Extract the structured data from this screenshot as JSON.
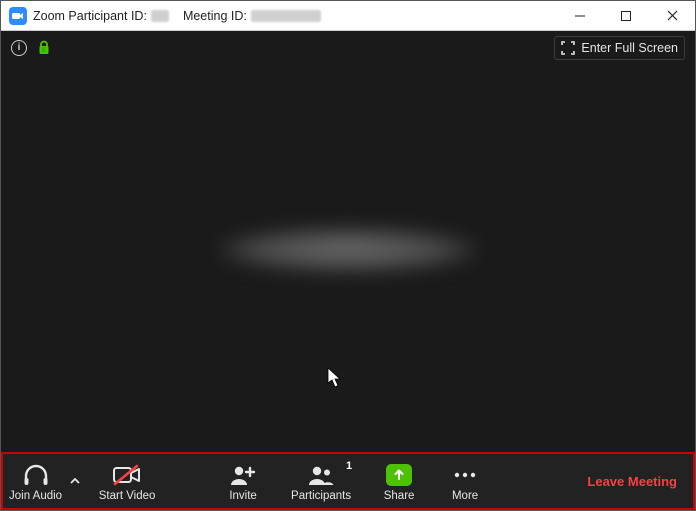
{
  "titlebar": {
    "prefix": "Zoom Participant ID:",
    "meeting_label": "Meeting ID:"
  },
  "infobar": {
    "fullscreen_label": "Enter Full Screen"
  },
  "toolbar": {
    "join_audio": "Join Audio",
    "start_video": "Start Video",
    "invite": "Invite",
    "participants": "Participants",
    "participants_count": "1",
    "share": "Share",
    "more": "More",
    "leave": "Leave Meeting"
  }
}
